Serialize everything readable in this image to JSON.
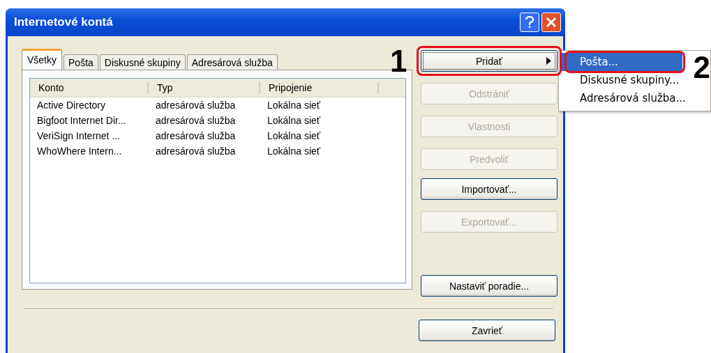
{
  "window": {
    "title": "Internetové kontá"
  },
  "tabs": [
    {
      "label": "Všetky",
      "selected": true
    },
    {
      "label": "Pošta",
      "selected": false
    },
    {
      "label": "Diskusné skupiny",
      "selected": false
    },
    {
      "label": "Adresárová služba",
      "selected": false
    }
  ],
  "table": {
    "columns": [
      "Konto",
      "Typ",
      "Pripojenie"
    ],
    "rows": [
      [
        "Active Directory",
        "adresárová služba",
        "Lokálna sieť"
      ],
      [
        "Bigfoot Internet Dir...",
        "adresárová služba",
        "Lokálna sieť"
      ],
      [
        "VeriSign Internet ...",
        "adresárová služba",
        "Lokálna sieť"
      ],
      [
        "WhoWhere Intern...",
        "adresárová služba",
        "Lokálna sieť"
      ]
    ]
  },
  "buttons": [
    {
      "label": "Pridať",
      "disabled": false,
      "focused": true,
      "submenu": true,
      "annotation": "1"
    },
    {
      "label": "Odstrániť",
      "disabled": true,
      "focused": false,
      "submenu": false
    },
    {
      "label": "Vlastnosti",
      "disabled": true,
      "focused": false,
      "submenu": false
    },
    {
      "label": "Predvoliť",
      "disabled": true,
      "focused": false,
      "submenu": false
    },
    {
      "label": "Importovať...",
      "disabled": false,
      "focused": false,
      "submenu": false
    },
    {
      "label": "Exportovať...",
      "disabled": true,
      "focused": false,
      "submenu": false
    },
    {
      "label": "Nastaviť poradie...",
      "disabled": false,
      "focused": false,
      "submenu": false
    }
  ],
  "menu": {
    "annotation": "2",
    "items": [
      {
        "label": "Pošta...",
        "selected": true
      },
      {
        "label": "Diskusné skupiny...",
        "selected": false
      },
      {
        "label": "Adresárová služba...",
        "selected": false
      }
    ]
  },
  "close_button": {
    "label": "Zavrieť"
  }
}
